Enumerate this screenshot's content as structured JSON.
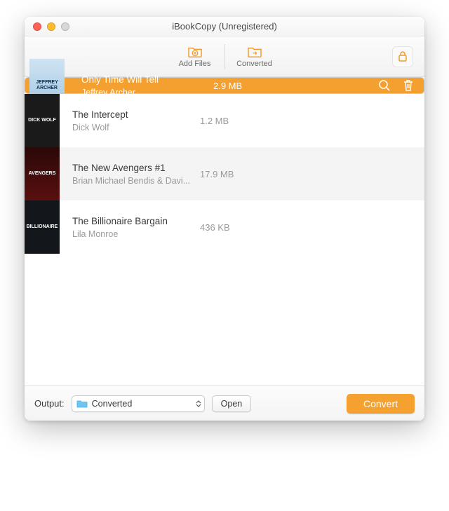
{
  "window": {
    "title": "iBookCopy (Unregistered)"
  },
  "toolbar": {
    "add_files_label": "Add Files",
    "converted_label": "Converted"
  },
  "colors": {
    "accent": "#f5a12f"
  },
  "books": [
    {
      "title": "Only Time Will Tell",
      "author": "Jeffrey Archer",
      "size": "2.9 MB",
      "cover_text": "JEFFREY ARCHER",
      "selected": true
    },
    {
      "title": "The Intercept",
      "author": "Dick Wolf",
      "size": "1.2 MB",
      "cover_text": "DICK WOLF",
      "selected": false
    },
    {
      "title": "The New Avengers #1",
      "author": "Brian Michael Bendis & Davi...",
      "size": "17.9 MB",
      "cover_text": "AVENGERS",
      "selected": false
    },
    {
      "title": "The Billionaire Bargain",
      "author": "Lila Monroe",
      "size": "436 KB",
      "cover_text": "BILLIONAIRE",
      "selected": false
    }
  ],
  "footer": {
    "output_label": "Output:",
    "output_value": "Converted",
    "open_label": "Open",
    "convert_label": "Convert"
  }
}
